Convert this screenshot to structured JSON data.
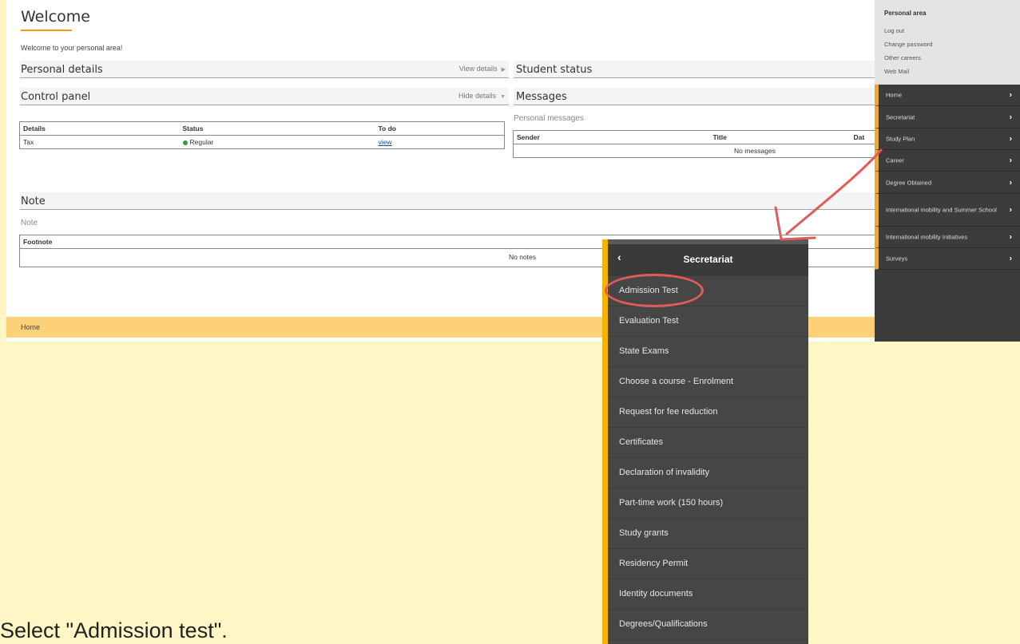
{
  "page": {
    "title": "Welcome",
    "welcome_text": "Welcome to your personal area!"
  },
  "panels": {
    "personal_details": {
      "title": "Personal details",
      "action": "View details"
    },
    "student_status": {
      "title": "Student status"
    },
    "control_panel": {
      "title": "Control panel",
      "action": "Hide details"
    },
    "messages": {
      "title": "Messages",
      "sub": "Personal messages"
    },
    "note": {
      "title": "Note",
      "sub": "Note"
    }
  },
  "control_table": {
    "headers": [
      "Details",
      "Status",
      "To do"
    ],
    "rows": [
      {
        "details": "Tax",
        "status": "Regular",
        "todo": "view"
      }
    ]
  },
  "messages_table": {
    "headers": [
      "Sender",
      "Title",
      "Dat"
    ],
    "empty": "No messages"
  },
  "notes_table": {
    "headers": [
      "Footnote"
    ],
    "empty": "No notes"
  },
  "footer": {
    "breadcrumb": "Home"
  },
  "personal_area": {
    "title": "Personal area",
    "links": [
      "Log out",
      "Change password",
      "Other careers",
      "Web Mail"
    ]
  },
  "sidebar": {
    "items": [
      {
        "label": "Home"
      },
      {
        "label": "Secretariat"
      },
      {
        "label": "Study Plan"
      },
      {
        "label": "Career"
      },
      {
        "label": "Degree Obtained"
      },
      {
        "label": "International mobility and Summer School"
      },
      {
        "label": "International mobility Initiatives"
      },
      {
        "label": "Surveys"
      }
    ]
  },
  "secretariat_menu": {
    "title": "Secretariat",
    "items": [
      "Admission Test",
      "Evaluation Test",
      "State Exams",
      "Choose a course - Enrolment",
      "Request for fee reduction",
      "Certificates",
      "Declaration of invalidity",
      "Part-time work (150 hours)",
      "Study grants",
      "Residency Permit",
      "Identity documents",
      "Degrees/Qualifications"
    ]
  },
  "caption": "Select \"Admission test\".",
  "colors": {
    "background": "#fff6c5",
    "accent_yellow": "#f5b301",
    "highlight_red": "#e35a5a",
    "sidebar_dark": "#3c3c3c",
    "footer": "#fdd177"
  }
}
